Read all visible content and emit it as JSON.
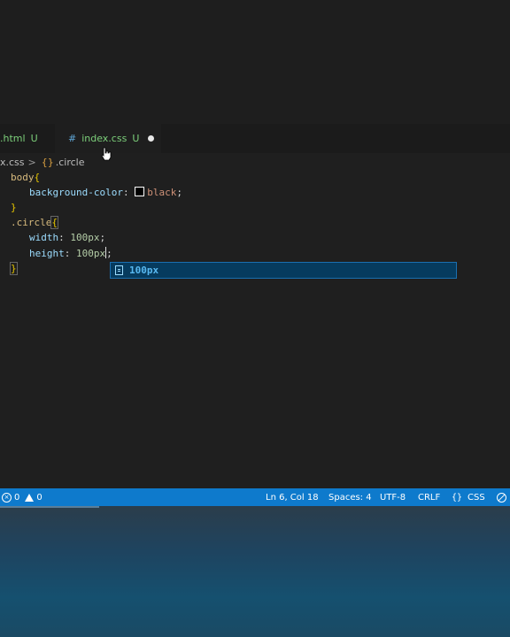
{
  "tabs": [
    {
      "label": ".html",
      "status": "U"
    },
    {
      "label": "index.css",
      "status": "U",
      "icon": "#",
      "dirty": true
    }
  ],
  "breadcrumb": {
    "file": "x.css",
    "separator": ">",
    "symbol_icon": "{}",
    "symbol": ".circle"
  },
  "code": {
    "l1_sel": "body",
    "l1_open": "{",
    "l2_prop": "background-color",
    "l2_colon": ": ",
    "l2_val": "black",
    "l2_end": ";",
    "l3_close": "}",
    "l4_sel": ".circle",
    "l4_open": "{",
    "l5_prop": "width",
    "l5_colon": ": ",
    "l5_val": "100px",
    "l5_end": ";",
    "l6_prop": "height",
    "l6_colon": ": ",
    "l6_val": "100px",
    "l6_end": ";",
    "l7_close": "}"
  },
  "suggestion": {
    "label": "100px"
  },
  "status": {
    "errors": "0",
    "warnings": "0",
    "position": "Ln 6, Col 18",
    "spaces": "Spaces: 4",
    "encoding": "UTF-8",
    "eol": "CRLF",
    "language": "CSS"
  },
  "colors": {
    "statusbar": "#0e7acc",
    "suggest_bg": "#063b5e",
    "tab_label": "#7ccf7a"
  }
}
